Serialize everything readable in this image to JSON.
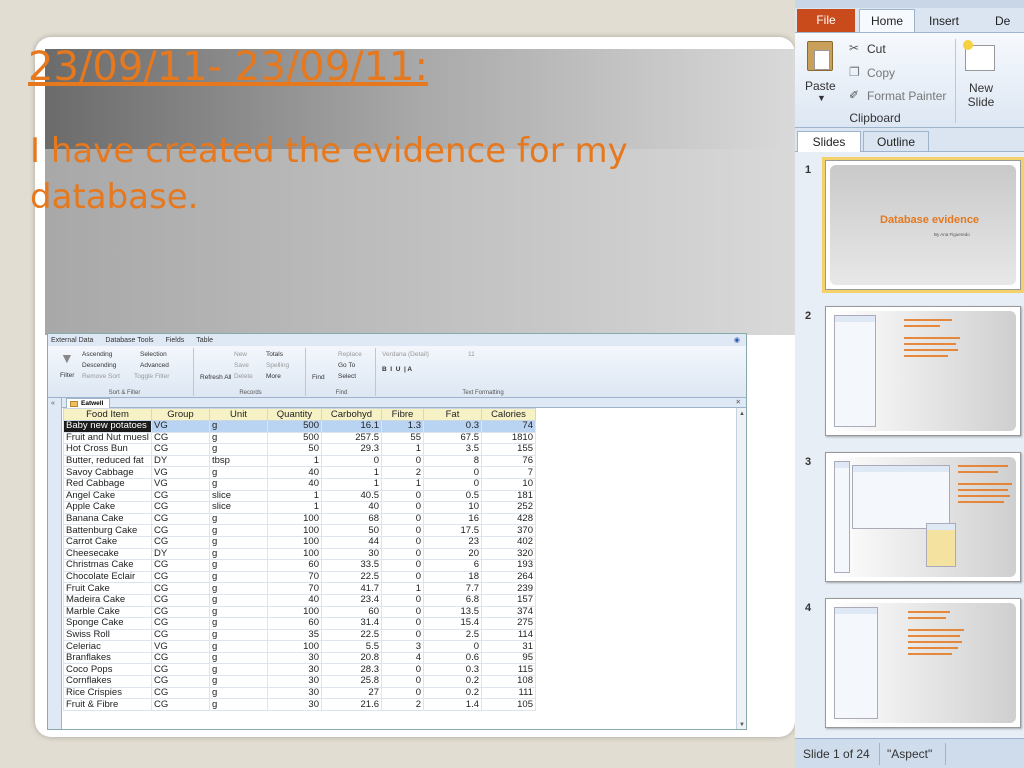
{
  "slide": {
    "title": "23/09/11- 23/09/11:",
    "body": "I have created the evidence for my database."
  },
  "access": {
    "ribbon_tabs": [
      "External Data",
      "Database Tools",
      "Fields",
      "Table"
    ],
    "ribbon": {
      "filter": "Filter",
      "ascending": "Ascending",
      "descending": "Descending",
      "remove_sort": "Remove Sort",
      "selection": "Selection",
      "advanced": "Advanced",
      "toggle_filter": "Toggle Filter",
      "sort_filter_label": "Sort & Filter",
      "refresh_all": "Refresh All",
      "new": "New",
      "save": "Save",
      "delete": "Delete",
      "totals": "Totals",
      "spelling": "Spelling",
      "more": "More",
      "records_label": "Records",
      "find": "Find",
      "replace": "Replace",
      "go_to": "Go To",
      "select": "Select",
      "find_label": "Find",
      "font_name": "Verdana (Detail)",
      "font_size": "11",
      "text_formatting_label": "Text Formatting"
    },
    "doc_tab": "Eatwell",
    "columns": [
      "Food Item",
      "Group",
      "Unit",
      "Quantity",
      "Carbohyd",
      "Fibre",
      "Fat",
      "Calories"
    ],
    "rows": [
      [
        "Baby new potatoes",
        "VG",
        "g",
        "500",
        "16.1",
        "1.3",
        "0.3",
        "74"
      ],
      [
        "Fruit and Nut muesl",
        "CG",
        "g",
        "500",
        "257.5",
        "55",
        "67.5",
        "1810"
      ],
      [
        "Hot Cross Bun",
        "CG",
        "g",
        "50",
        "29.3",
        "1",
        "3.5",
        "155"
      ],
      [
        "Butter, reduced fat",
        "DY",
        "tbsp",
        "1",
        "0",
        "0",
        "8",
        "76"
      ],
      [
        "Savoy Cabbage",
        "VG",
        "g",
        "40",
        "1",
        "2",
        "0",
        "7"
      ],
      [
        "Red Cabbage",
        "VG",
        "g",
        "40",
        "1",
        "1",
        "0",
        "10"
      ],
      [
        "Angel Cake",
        "CG",
        "slice",
        "1",
        "40.5",
        "0",
        "0.5",
        "181"
      ],
      [
        "Apple Cake",
        "CG",
        "slice",
        "1",
        "40",
        "0",
        "10",
        "252"
      ],
      [
        "Banana Cake",
        "CG",
        "g",
        "100",
        "68",
        "0",
        "16",
        "428"
      ],
      [
        "Battenburg Cake",
        "CG",
        "g",
        "100",
        "50",
        "0",
        "17.5",
        "370"
      ],
      [
        "Carrot Cake",
        "CG",
        "g",
        "100",
        "44",
        "0",
        "23",
        "402"
      ],
      [
        "Cheesecake",
        "DY",
        "g",
        "100",
        "30",
        "0",
        "20",
        "320"
      ],
      [
        "Christmas Cake",
        "CG",
        "g",
        "60",
        "33.5",
        "0",
        "6",
        "193"
      ],
      [
        "Chocolate Éclair",
        "CG",
        "g",
        "70",
        "22.5",
        "0",
        "18",
        "264"
      ],
      [
        "Fruit Cake",
        "CG",
        "g",
        "70",
        "41.7",
        "1",
        "7.7",
        "239"
      ],
      [
        "Madeira Cake",
        "CG",
        "g",
        "40",
        "23.4",
        "0",
        "6.8",
        "157"
      ],
      [
        "Marble Cake",
        "CG",
        "g",
        "100",
        "60",
        "0",
        "13.5",
        "374"
      ],
      [
        "Sponge Cake",
        "CG",
        "g",
        "60",
        "31.4",
        "0",
        "15.4",
        "275"
      ],
      [
        "Swiss Roll",
        "CG",
        "g",
        "35",
        "22.5",
        "0",
        "2.5",
        "114"
      ],
      [
        "Celeriac",
        "VG",
        "g",
        "100",
        "5.5",
        "3",
        "0",
        "31"
      ],
      [
        "Branflakes",
        "CG",
        "g",
        "30",
        "20.8",
        "4",
        "0.6",
        "95"
      ],
      [
        "Coco Pops",
        "CG",
        "g",
        "30",
        "28.3",
        "0",
        "0.3",
        "115"
      ],
      [
        "Cornflakes",
        "CG",
        "g",
        "30",
        "25.8",
        "0",
        "0.2",
        "108"
      ],
      [
        "Rice Crispies",
        "CG",
        "g",
        "30",
        "27",
        "0",
        "0.2",
        "111"
      ],
      [
        "Fruit & Fibre",
        "CG",
        "g",
        "30",
        "21.6",
        "2",
        "1.4",
        "105"
      ]
    ]
  },
  "powerpoint": {
    "tabs": {
      "file": "File",
      "home": "Home",
      "insert": "Insert",
      "design": "De"
    },
    "ribbon": {
      "paste": "Paste",
      "cut": "Cut",
      "copy": "Copy",
      "format_painter": "Format Painter",
      "clipboard_label": "Clipboard",
      "new_slide": "New Slide"
    },
    "pane_tabs": {
      "slides": "Slides",
      "outline": "Outline"
    },
    "thumbnails": [
      {
        "num": "1",
        "title": "Database evidence",
        "subtitle": "By Ana Figueredo"
      },
      {
        "num": "2"
      },
      {
        "num": "3"
      },
      {
        "num": "4"
      }
    ],
    "status": {
      "slide_count": "Slide 1 of 24",
      "theme": "\"Aspect\""
    }
  },
  "colors": {
    "accent": "#e6781e",
    "file_tab": "#c94a1b",
    "selection": "#b9d3f2",
    "header_fill": "#f7f1c6"
  }
}
